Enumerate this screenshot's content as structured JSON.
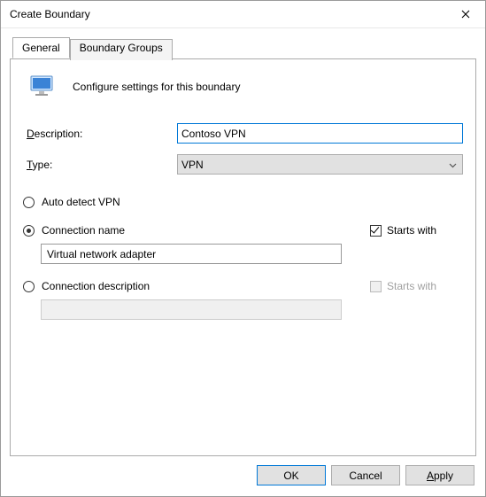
{
  "title": "Create Boundary",
  "tabs": {
    "general": "General",
    "groups": "Boundary Groups"
  },
  "header_text": "Configure settings for this boundary",
  "form": {
    "description_label_pre": "D",
    "description_label_rest": "escription:",
    "description_value": "Contoso VPN",
    "type_label_pre": "T",
    "type_label_rest": "ype:",
    "type_value": "VPN"
  },
  "options": {
    "auto_detect": "Auto detect VPN",
    "connection_name": "Connection name",
    "connection_name_starts_with": "Starts with",
    "connection_name_value": "Virtual network adapter",
    "connection_desc": "Connection description",
    "connection_desc_starts_with": "Starts with"
  },
  "buttons": {
    "ok": "OK",
    "cancel": "Cancel",
    "apply_pre": "A",
    "apply_rest": "pply"
  }
}
